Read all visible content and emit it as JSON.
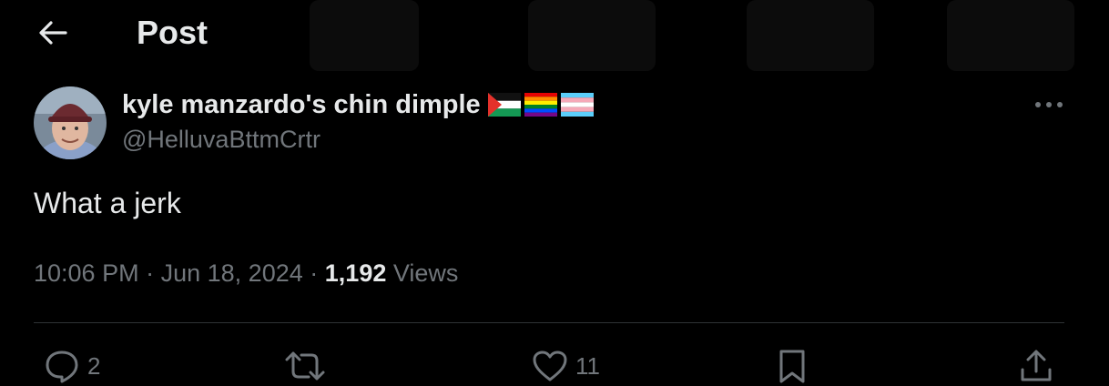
{
  "header": {
    "back_icon": "arrow-left-icon",
    "title": "Post"
  },
  "post": {
    "author": {
      "display_name": "kyle manzardo's chin dimple",
      "flags": [
        "palestine-flag",
        "rainbow-pride-flag",
        "transgender-pride-flag"
      ],
      "handle": "@HelluvaBttmCrtr"
    },
    "more_icon": "more-horizontal-icon",
    "text": "What a jerk",
    "time": "10:06 PM",
    "separator": "·",
    "date": "Jun 18, 2024",
    "views_count": "1,192",
    "views_label": "Views"
  },
  "actions": {
    "reply": {
      "icon": "reply-icon",
      "count": "2"
    },
    "repost": {
      "icon": "repost-icon",
      "count": ""
    },
    "like": {
      "icon": "heart-icon",
      "count": "11"
    },
    "bookmark": {
      "icon": "bookmark-icon"
    },
    "share": {
      "icon": "share-icon"
    }
  },
  "colors": {
    "background": "#000000",
    "text_primary": "#e7e9ea",
    "text_secondary": "#71767b",
    "divider": "#2f3336"
  }
}
